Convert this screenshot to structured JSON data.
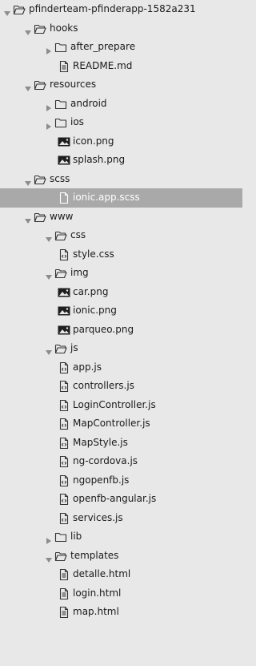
{
  "tree": [
    {
      "label": "pfinderteam-pfinderapp-1582a231",
      "kind": "folder",
      "depth": 0,
      "open": true
    },
    {
      "label": "hooks",
      "kind": "folder",
      "depth": 1,
      "open": true
    },
    {
      "label": "after_prepare",
      "kind": "folder",
      "depth": 2,
      "open": false
    },
    {
      "label": "README.md",
      "kind": "text",
      "depth": 3
    },
    {
      "label": "resources",
      "kind": "folder",
      "depth": 1,
      "open": true
    },
    {
      "label": "android",
      "kind": "folder",
      "depth": 2,
      "open": false
    },
    {
      "label": "ios",
      "kind": "folder",
      "depth": 2,
      "open": false
    },
    {
      "label": "icon.png",
      "kind": "image",
      "depth": 3
    },
    {
      "label": "splash.png",
      "kind": "image",
      "depth": 3
    },
    {
      "label": "scss",
      "kind": "folder",
      "depth": 1,
      "open": true
    },
    {
      "label": "ionic.app.scss",
      "kind": "file",
      "depth": 3,
      "selected": true
    },
    {
      "label": "www",
      "kind": "folder",
      "depth": 1,
      "open": true
    },
    {
      "label": "css",
      "kind": "folder",
      "depth": 2,
      "open": true
    },
    {
      "label": "style.css",
      "kind": "code",
      "depth": 3
    },
    {
      "label": "img",
      "kind": "folder",
      "depth": 2,
      "open": true
    },
    {
      "label": "car.png",
      "kind": "image",
      "depth": 3
    },
    {
      "label": "ionic.png",
      "kind": "image",
      "depth": 3
    },
    {
      "label": "parqueo.png",
      "kind": "image",
      "depth": 3
    },
    {
      "label": "js",
      "kind": "folder",
      "depth": 2,
      "open": true
    },
    {
      "label": "app.js",
      "kind": "code",
      "depth": 3
    },
    {
      "label": "controllers.js",
      "kind": "code",
      "depth": 3
    },
    {
      "label": "LoginController.js",
      "kind": "code",
      "depth": 3
    },
    {
      "label": "MapController.js",
      "kind": "code",
      "depth": 3
    },
    {
      "label": "MapStyle.js",
      "kind": "code",
      "depth": 3
    },
    {
      "label": "ng-cordova.js",
      "kind": "code",
      "depth": 3
    },
    {
      "label": "ngopenfb.js",
      "kind": "code",
      "depth": 3
    },
    {
      "label": "openfb-angular.js",
      "kind": "code",
      "depth": 3
    },
    {
      "label": "services.js",
      "kind": "code",
      "depth": 3
    },
    {
      "label": "lib",
      "kind": "folder",
      "depth": 2,
      "open": false
    },
    {
      "label": "templates",
      "kind": "folder",
      "depth": 2,
      "open": true
    },
    {
      "label": "detalle.html",
      "kind": "text",
      "depth": 3
    },
    {
      "label": "login.html",
      "kind": "text",
      "depth": 3
    },
    {
      "label": "map.html",
      "kind": "text",
      "depth": 3
    }
  ]
}
